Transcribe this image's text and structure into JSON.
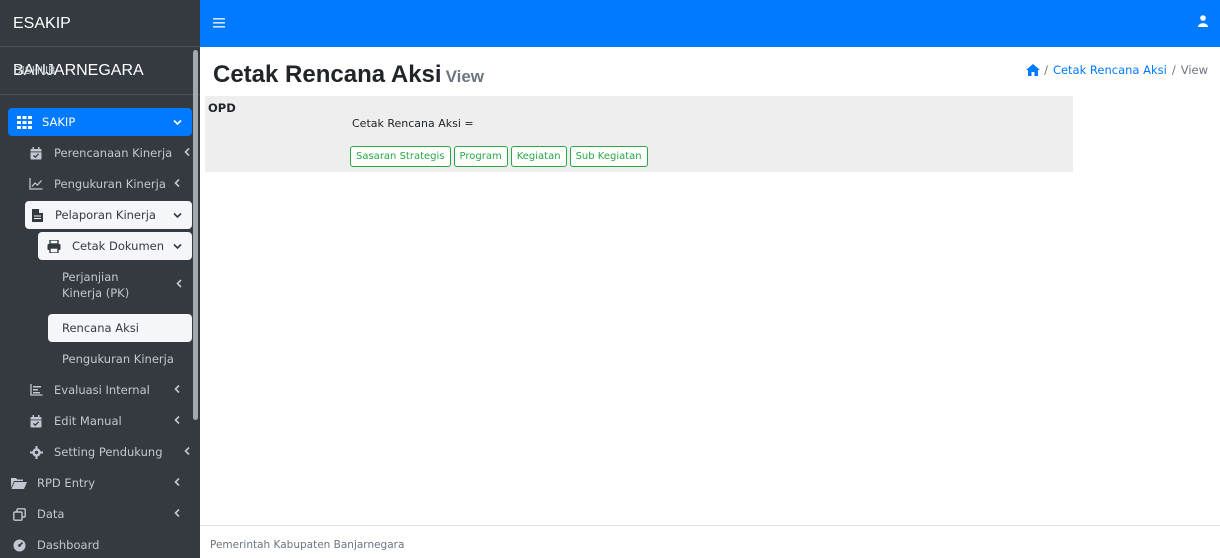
{
  "brand": "ESAKIP BANJARNEGARA",
  "user_panel": "DISHUB",
  "sidebar": {
    "items": [
      {
        "label": "SAKIP",
        "icon": "grid-icon"
      },
      {
        "label": "Perencanaan Kinerja",
        "icon": "calendar-check-icon"
      },
      {
        "label": "Pengukuran Kinerja",
        "icon": "line-chart-icon"
      },
      {
        "label": "Pelaporan Kinerja",
        "icon": "file-icon"
      },
      {
        "label": "Cetak Dokumen",
        "icon": "print-icon"
      },
      {
        "label": "Perjanjian Kinerja (PK)"
      },
      {
        "label": "Rencana Aksi"
      },
      {
        "label": "Pengukuran Kinerja"
      },
      {
        "label": "Evaluasi Internal",
        "icon": "bar-chart-icon"
      },
      {
        "label": "Edit Manual",
        "icon": "calendar-check-icon"
      },
      {
        "label": "Setting Pendukung",
        "icon": "gear-icon"
      },
      {
        "label": "RPD Entry",
        "icon": "folder-open-icon"
      },
      {
        "label": "Data",
        "icon": "clone-icon"
      },
      {
        "label": "Dashboard",
        "icon": "dashboard-icon"
      }
    ]
  },
  "page": {
    "title": "Cetak Rencana Aksi",
    "subtitle": "View"
  },
  "breadcrumb": {
    "home_icon": "home-icon",
    "link": "Cetak Rencana Aksi",
    "current": "View"
  },
  "card": {
    "opd_label": "OPD",
    "cetak_label": "Cetak Rencana Aksi =",
    "buttons": [
      "Sasaran Strategis",
      "Program",
      "Kegiatan",
      "Sub Kegiatan"
    ]
  },
  "footer": "Pemerintah Kabupaten Banjarnegara",
  "colors": {
    "primary": "#007bff",
    "sidebar": "#343a40",
    "success": "#28a745"
  }
}
